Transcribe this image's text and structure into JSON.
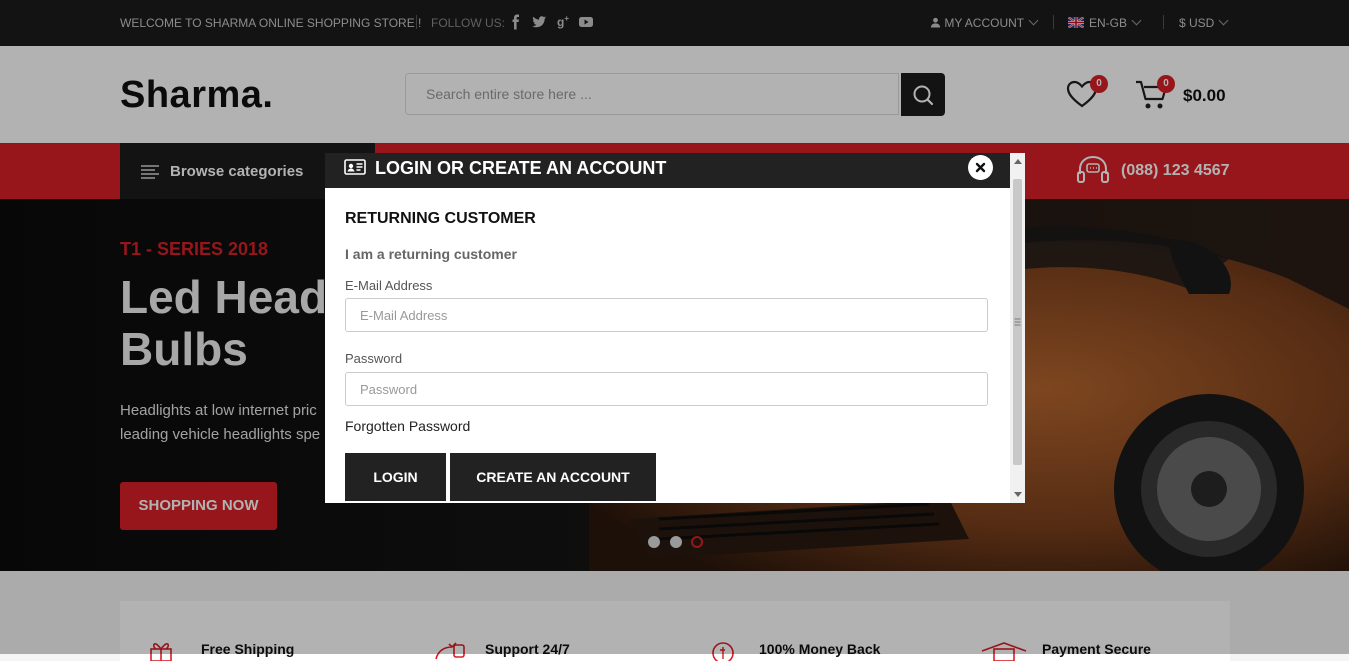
{
  "topbar": {
    "welcome": "WELCOME TO SHARMA ONLINE SHOPPING STORE !",
    "follow_us": "FOLLOW US:",
    "social": [
      "f",
      "t",
      "g+",
      "yt"
    ],
    "my_account": "MY ACCOUNT",
    "language": "EN-GB",
    "currency": "$ USD"
  },
  "header": {
    "logo": "Sharma.",
    "search_placeholder": "Search entire store here ...",
    "wishlist_count": "0",
    "cart_count": "0",
    "cart_total": "$0.00"
  },
  "nav": {
    "browse_label": "Browse categories",
    "phone": "(088) 123 4567"
  },
  "hero": {
    "tag": "T1 - SERIES 2018",
    "title_line1": "Led Head",
    "title_line2": "Bulbs",
    "desc_line1": "Headlights at low internet pric",
    "desc_line2": "leading vehicle headlights spe",
    "button": "SHOPPING NOW",
    "slides_total": 3,
    "active_slide": 3
  },
  "features": [
    {
      "label": "Free Shipping"
    },
    {
      "label": "Support 24/7"
    },
    {
      "label": "100% Money Back"
    },
    {
      "label": "Payment Secure"
    }
  ],
  "modal": {
    "title": "LOGIN OR CREATE AN ACCOUNT",
    "section_title": "RETURNING CUSTOMER",
    "subtitle": "I am a returning customer",
    "email_label": "E-Mail Address",
    "email_placeholder": "E-Mail Address",
    "password_label": "Password",
    "password_placeholder": "Password",
    "forgot": "Forgotten Password",
    "login_button": "LOGIN",
    "create_button": "CREATE AN ACCOUNT"
  },
  "colors": {
    "accent": "#d72027",
    "dark": "#1c1c1c"
  }
}
